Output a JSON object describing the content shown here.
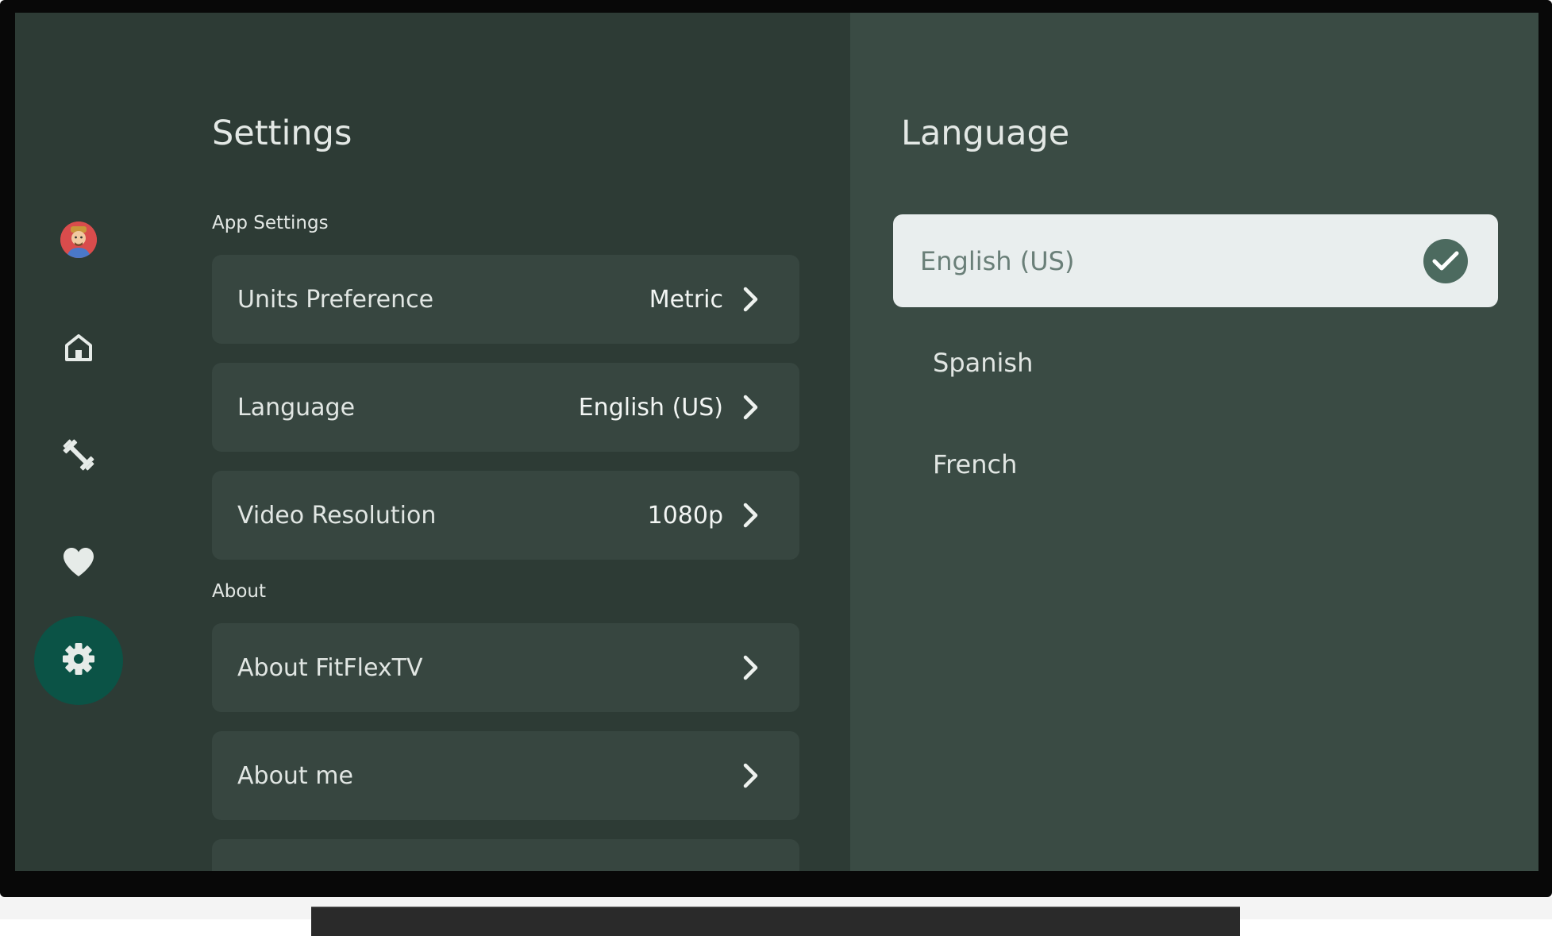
{
  "nav": {
    "items": [
      {
        "name": "avatar",
        "icon": "avatar-icon"
      },
      {
        "name": "home",
        "icon": "home-icon"
      },
      {
        "name": "workouts",
        "icon": "dumbbell-icon"
      },
      {
        "name": "favorites",
        "icon": "heart-icon"
      },
      {
        "name": "settings",
        "icon": "gear-icon",
        "active": true
      }
    ],
    "active_color": "#0b5346"
  },
  "settings": {
    "title": "Settings",
    "app_settings_label": "App Settings",
    "rows": [
      {
        "label": "Units Preference",
        "value": "Metric"
      },
      {
        "label": "Language",
        "value": "English (US)"
      },
      {
        "label": "Video Resolution",
        "value": "1080p"
      }
    ],
    "about_label": "About",
    "about_rows": [
      {
        "label": "About FitFlexTV"
      },
      {
        "label": "About me"
      }
    ]
  },
  "language_panel": {
    "title": "Language",
    "options": [
      {
        "label": "English (US)",
        "selected": true
      },
      {
        "label": "Spanish",
        "selected": false
      },
      {
        "label": "French",
        "selected": false
      }
    ]
  },
  "colors": {
    "background": "#2d3b35",
    "panel": "#3a4b44",
    "row": "#374640",
    "selected_option": "#e9eeee",
    "check": "#4c6a5f"
  }
}
